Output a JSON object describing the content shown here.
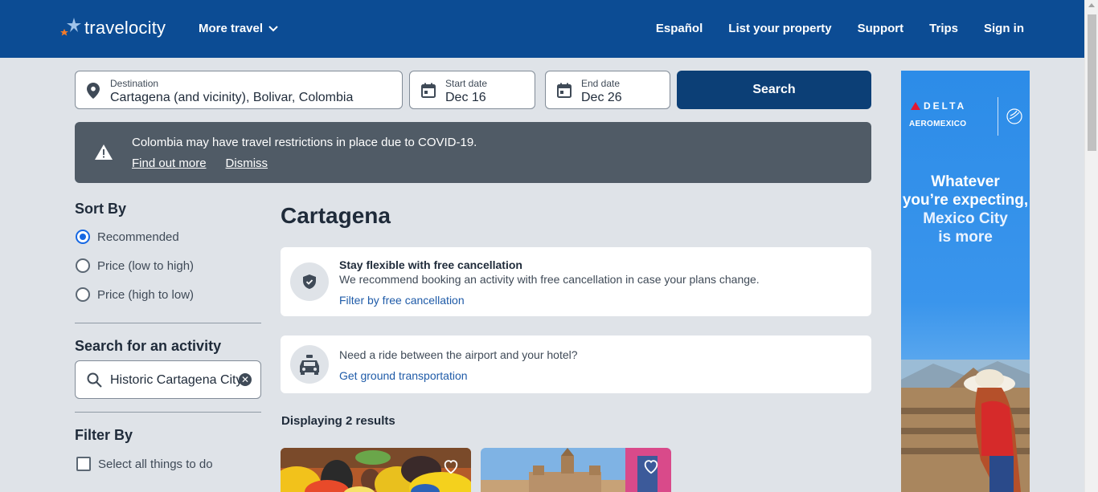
{
  "header": {
    "logo_text": "travelocity",
    "more_travel": "More travel",
    "nav": [
      "Español",
      "List your property",
      "Support",
      "Trips",
      "Sign in"
    ]
  },
  "search": {
    "destination_label": "Destination",
    "destination_value": "Cartagena (and vicinity), Bolivar, Colombia",
    "start_label": "Start date",
    "start_value": "Dec 16",
    "end_label": "End date",
    "end_value": "Dec 26",
    "button": "Search"
  },
  "alert": {
    "message": "Colombia may have travel restrictions in place due to COVID-19.",
    "find_out": "Find out more",
    "dismiss": "Dismiss"
  },
  "sidebar": {
    "sort_title": "Sort By",
    "sort_options": [
      "Recommended",
      "Price (low to high)",
      "Price (high to low)"
    ],
    "sort_selected": "Recommended",
    "activity_title": "Search for an activity",
    "activity_value": "Historic Cartagena City",
    "filter_title": "Filter By",
    "select_all": "Select all things to do"
  },
  "main": {
    "title": "Cartagena",
    "flex_card": {
      "title": "Stay flexible with free cancellation",
      "text": "We recommend booking an activity with free cancellation in case your plans change.",
      "link": "Filter by free cancellation"
    },
    "ride_card": {
      "text": "Need a ride between the airport and your hotel?",
      "link": "Get ground transportation"
    },
    "results_count": "Displaying 2 results"
  },
  "ad": {
    "brand1": "DELTA",
    "brand2": "AEROMEXICO",
    "line1": "Whatever",
    "line2": "you’re expecting,",
    "line3": "Mexico City",
    "line4": "is more"
  },
  "colors": {
    "header_bg": "#0c4c94",
    "primary_button": "#0c3f76",
    "link": "#1f5ba8",
    "alert_bg": "#505b66",
    "page_bg": "#dfe3e8"
  }
}
